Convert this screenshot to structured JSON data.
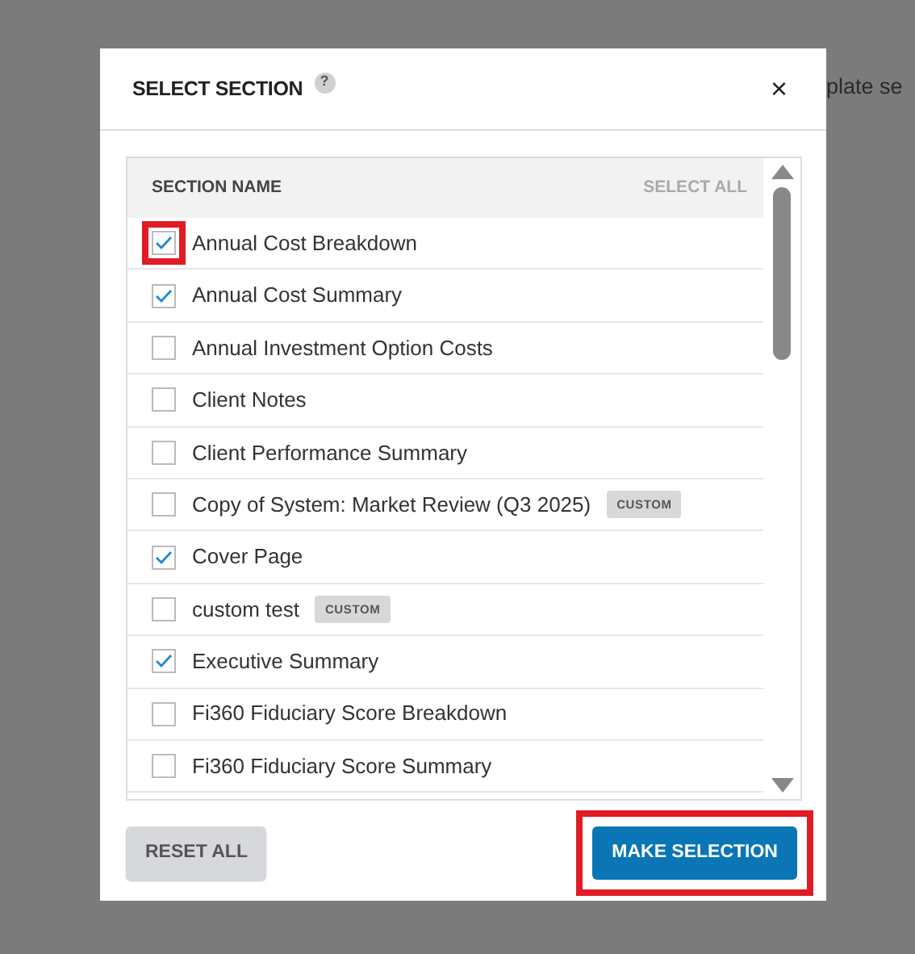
{
  "background_text": "plate se",
  "dialog": {
    "title": "SELECT SECTION",
    "help_icon": "?",
    "close": "×"
  },
  "list": {
    "column_header": "SECTION NAME",
    "select_all": "SELECT ALL",
    "rows": [
      {
        "label": "Annual Cost Breakdown",
        "checked": true,
        "highlighted": true
      },
      {
        "label": "Annual Cost Summary",
        "checked": true,
        "highlighted": false
      },
      {
        "label": "Annual Investment Option Costs",
        "checked": false,
        "highlighted": false
      },
      {
        "label": "Client Notes",
        "checked": false,
        "highlighted": false
      },
      {
        "label": "Client Performance Summary",
        "checked": false,
        "highlighted": false
      },
      {
        "label": "Copy of System: Market Review (Q3 2025)",
        "checked": false,
        "highlighted": false,
        "tag": "CUSTOM"
      },
      {
        "label": "Cover Page",
        "checked": true,
        "highlighted": false
      },
      {
        "label": "custom test",
        "checked": false,
        "highlighted": false,
        "tag": "CUSTOM"
      },
      {
        "label": "Executive Summary",
        "checked": true,
        "highlighted": false
      },
      {
        "label": "Fi360 Fiduciary Score Breakdown",
        "checked": false,
        "highlighted": false
      },
      {
        "label": "Fi360 Fiduciary Score Summary",
        "checked": false,
        "highlighted": false
      }
    ]
  },
  "buttons": [
    {
      "label": "RESET ALL",
      "kind": "secondary",
      "highlighted": false
    },
    {
      "label": "MAKE SELECTION",
      "kind": "primary",
      "highlighted": true
    }
  ]
}
